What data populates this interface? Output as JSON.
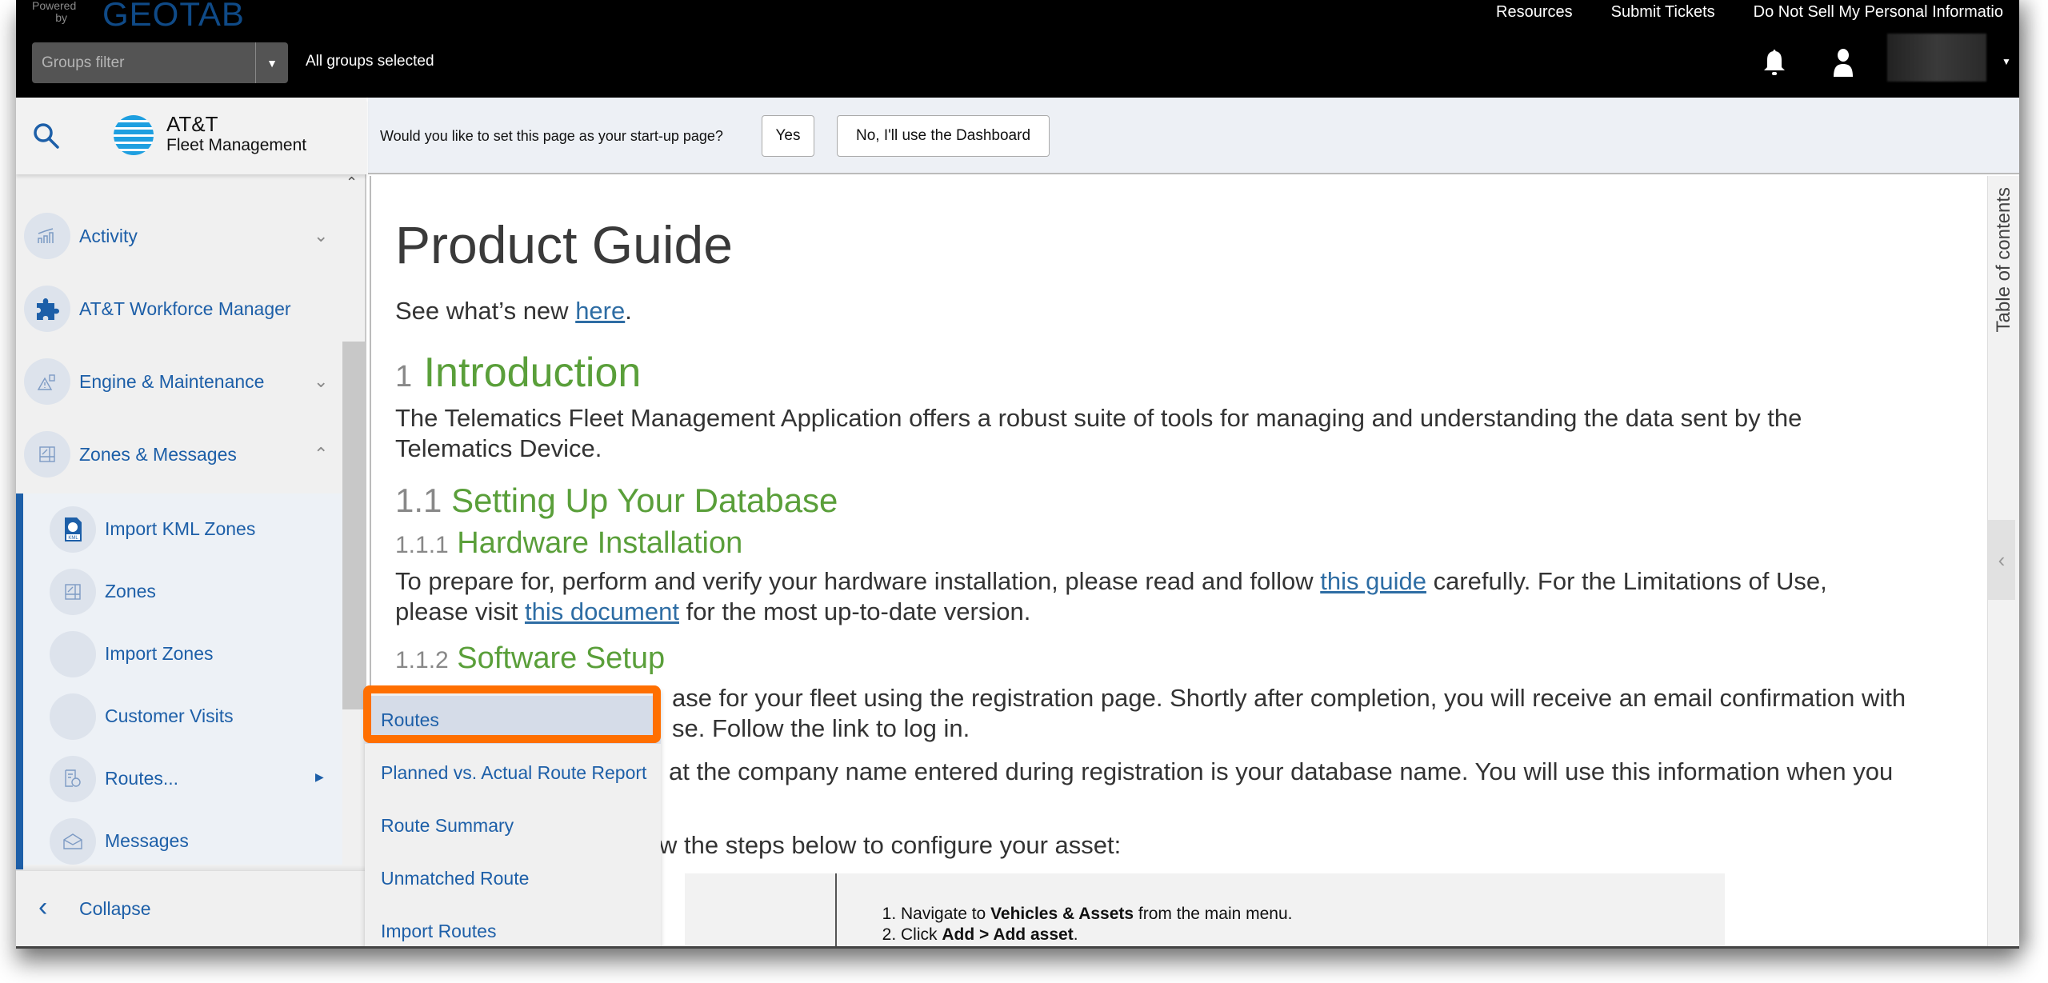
{
  "topbar": {
    "powered_by": "Powered by",
    "brand": "GEOTAB",
    "links": [
      "Resources",
      "Submit Tickets",
      "Do Not Sell My Personal Informatio"
    ],
    "groups_filter_placeholder": "Groups filter",
    "groups_status": "All groups selected",
    "icons": {
      "notifications": "bell-icon",
      "user": "user-icon",
      "menu": "caret-down-icon"
    }
  },
  "sidebar": {
    "logo_name": "AT&T",
    "logo_sub": "Fleet Management",
    "items": [
      {
        "label": "Activity",
        "icon": "chart-icon",
        "expand": "collapsed"
      },
      {
        "label": "AT&T Workforce Manager",
        "icon": "puzzle-icon",
        "expand": "none"
      },
      {
        "label": "Engine & Maintenance",
        "icon": "engine-warning-icon",
        "expand": "collapsed"
      },
      {
        "label": "Zones & Messages",
        "icon": "zone-icon",
        "expand": "expanded"
      }
    ],
    "sub_items": [
      {
        "label": "Import KML Zones",
        "icon": "kml-file-icon"
      },
      {
        "label": "Zones",
        "icon": "zone-icon"
      },
      {
        "label": "Import Zones",
        "icon": ""
      },
      {
        "label": "Customer Visits",
        "icon": ""
      },
      {
        "label": "Routes...",
        "icon": "route-icon",
        "has_submenu": true
      },
      {
        "label": "Messages",
        "icon": "envelope-icon"
      }
    ],
    "collapse_label": "Collapse"
  },
  "startup_prompt": {
    "question": "Would you like to set this page as your start-up page?",
    "yes_label": "Yes",
    "no_label": "No, I'll use the Dashboard"
  },
  "toc": {
    "label": "Table of contents"
  },
  "routes_submenu": {
    "items": [
      "Routes",
      "Planned vs. Actual Route Report",
      "Route Summary",
      "Unmatched Route",
      "Import Routes"
    ],
    "highlighted": "Routes",
    "highlight_color": "#ff6f00"
  },
  "document": {
    "title": "Product Guide",
    "whats_new_prefix": "See what’s new ",
    "whats_new_link": "here",
    "whats_new_suffix": ".",
    "intro_num": "1",
    "intro_title": "Introduction",
    "intro_p1": "The Telematics Fleet Management Application offers a robust suite of tools for managing and understanding the data sent by the",
    "intro_p2": "Telematics Device.",
    "s11_num": "1.1",
    "s11_title": "Setting Up Your Database",
    "s111_num": "1.1.1",
    "s111_title": "Hardware Installation",
    "hw_p1_a": "To prepare for, perform and verify your hardware installation, please read and follow ",
    "hw_p1_link": "this guide",
    "hw_p1_b": " carefully. For the Limitations of Use,",
    "hw_p2_a": "please visit ",
    "hw_p2_link": "this document",
    "hw_p2_b": " for the most up-to-date version.",
    "s112_num": "1.1.2",
    "s112_title": "Software Setup",
    "sw_p1": "ase for your fleet using the registration page. Shortly after completion, you will receive an email confirmation with",
    "sw_p2": "se. Follow the link to log in.",
    "sw_p3": "at the company name entered during registration is your database name. You will use this information when you",
    "sw_p4": "w the steps below to configure your asset:",
    "steps": [
      {
        "pre": "Navigate to ",
        "bold": "Vehicles & Assets",
        "post": " from the main menu."
      },
      {
        "pre": "Click ",
        "bold": "Add > Add asset",
        "post": "."
      }
    ],
    "accent_color": "#5a9f3a",
    "link_color": "#2e6da4"
  }
}
